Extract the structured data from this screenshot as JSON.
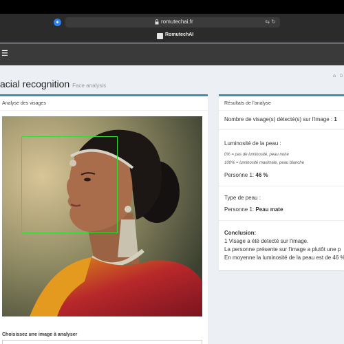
{
  "browser": {
    "url": "romutechai.fr",
    "tab_title": "RomutechAI",
    "ext_icon": "privacy-shield-icon",
    "url_right_icons": "⇆ ↻"
  },
  "navbar": {
    "menu_icon": "☰"
  },
  "page": {
    "title": "acial recognition",
    "subtitle": "Face analysis",
    "breadcrumb_icon": "⌂",
    "breadcrumb_text": "D"
  },
  "left_box": {
    "header": "Analyse des visages",
    "choose_label": "Choisissez une image à analyser"
  },
  "results": {
    "header": "Résultats de l'analyse",
    "faces_label": "Nombre de visage(s) détecté(s) sur l'image : ",
    "faces_value": "1",
    "luminosity_title": "Luminosité de la peau :",
    "luminosity_note_0": "0% = pas de luminosité, peau noire",
    "luminosity_note_100": "100% = luminosité maximale, peau blanche",
    "person1_lum_label": "Personne 1: ",
    "person1_lum_value": "46 %",
    "skin_type_title": "Type de peau :",
    "person1_type_label": "Personne 1: ",
    "person1_type_value": "Peau mate",
    "conclusion_title": "Conclusion:",
    "conclusion_line1": "1 Visage a été detecté sur l'image.",
    "conclusion_line2": "La personne présente sur l'image a plutôt une p",
    "conclusion_line3": "En moyenne la luminosité de la peau est de 46 %"
  },
  "colors": {
    "accent": "#3c8dbc",
    "face_box": "#33dd33",
    "background": "#ecf0f5",
    "navbar": "#3a3a3a"
  }
}
